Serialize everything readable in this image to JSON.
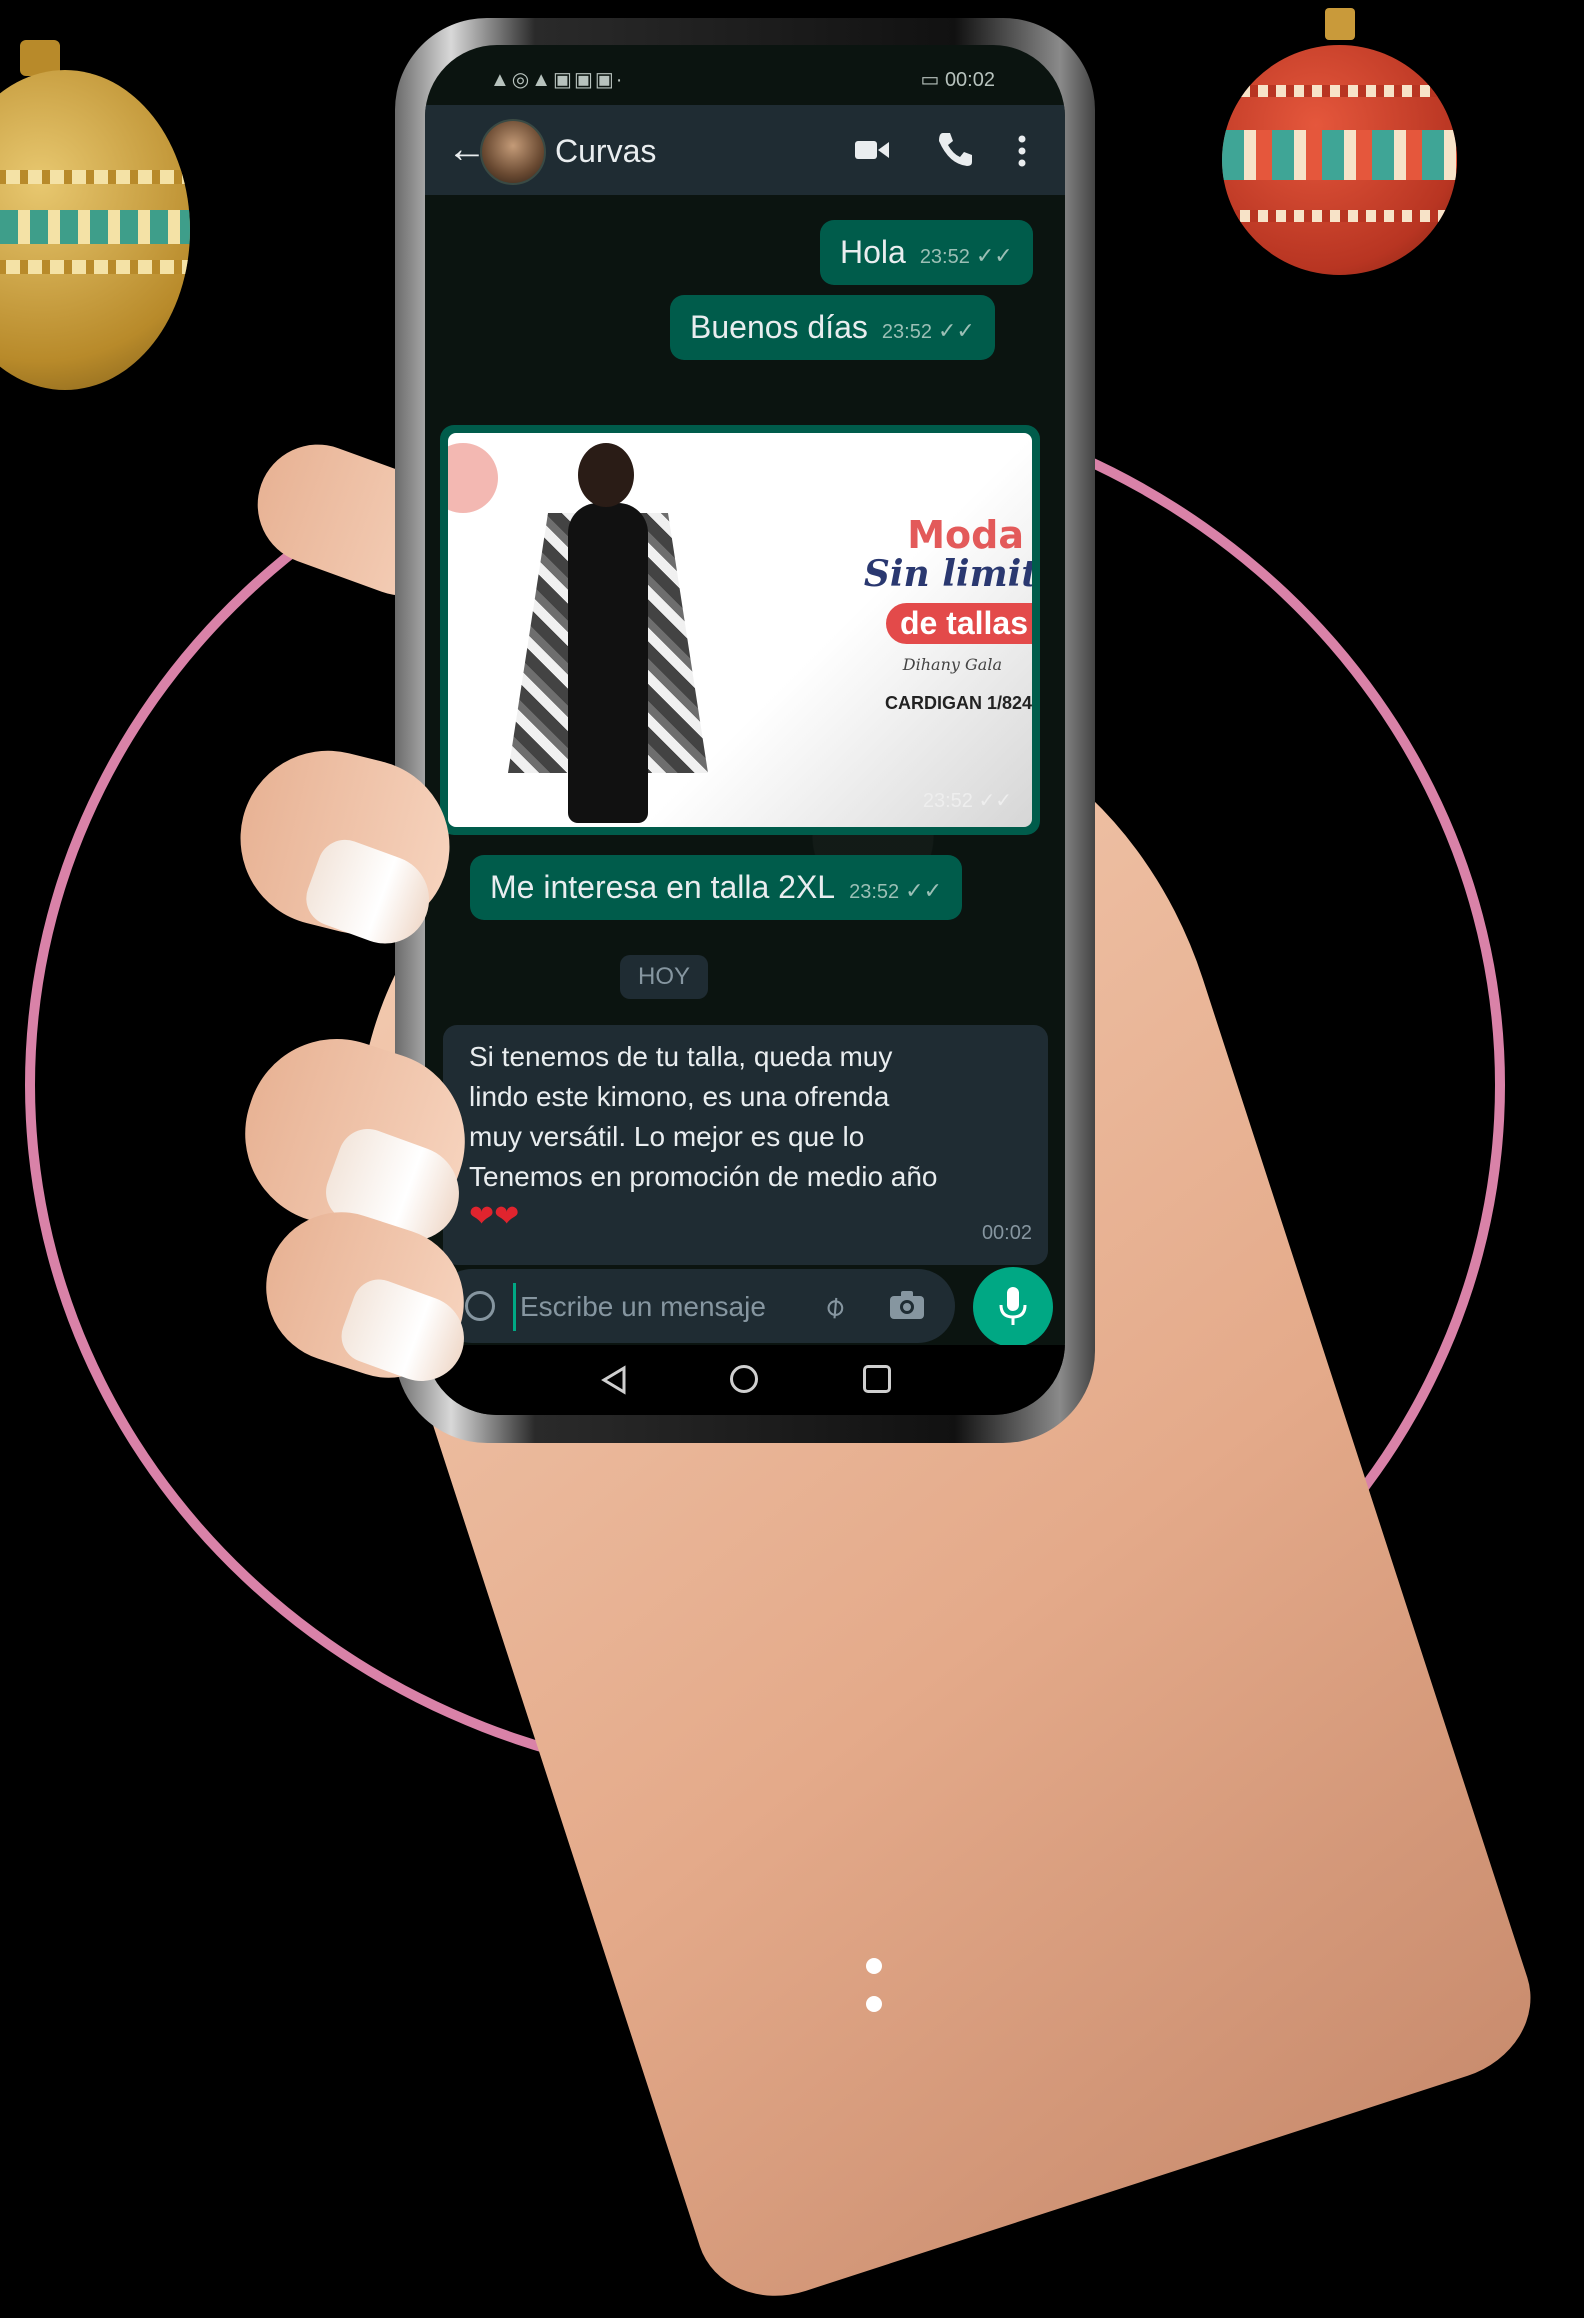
{
  "status_bar": {
    "left": "▲◎▲▣▣▣·",
    "right": "▭ 00:02"
  },
  "chat_header": {
    "contact_name": "Curvas"
  },
  "messages": {
    "m1": {
      "text": "Hola",
      "time": "23:52",
      "ticks": "✓✓"
    },
    "m2": {
      "text": "Buenos días",
      "time": "23:52",
      "ticks": "✓✓"
    },
    "image_msg": {
      "moda": "Moda",
      "sin_limite": "Sin limit",
      "de_tallas": "de tallas",
      "signature": "Dihany Gala",
      "cardigan": "CARDIGAN 1/824",
      "time": "23:52 ✓✓"
    },
    "m3": {
      "text": "Me interesa en talla 2XL",
      "time": "23:52",
      "ticks": "✓✓"
    },
    "date_chip": "HOY",
    "incoming": {
      "line1": "Si tenemos de tu talla, queda muy",
      "line2": "lindo este kimono, es una ofrenda",
      "line3": "muy  versátil. Lo mejor es que lo",
      "line4": "Tenemos en promoción de medio año",
      "hearts": "❤❤",
      "time": "00:02"
    }
  },
  "input_bar": {
    "placeholder": "Escribe un mensaje"
  },
  "colors": {
    "outgoing_bubble": "#005c4b",
    "incoming_bubble": "#1f2c33",
    "accent": "#00a884",
    "ring": "#d982a8"
  }
}
